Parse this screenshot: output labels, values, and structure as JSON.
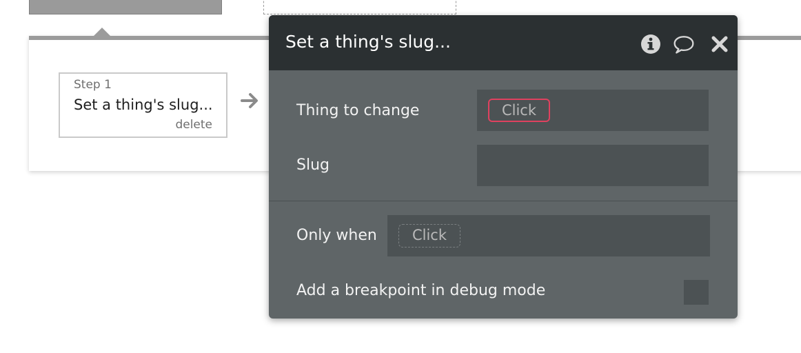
{
  "workflow": {
    "step": {
      "number_label": "Step 1",
      "title": "Set a thing's slug...",
      "delete_label": "delete"
    }
  },
  "editor": {
    "title": "Set a thing's slug...",
    "icons": {
      "info": "info-icon",
      "comment": "comment-icon",
      "close": "close-icon"
    },
    "fields": {
      "thing_to_change": {
        "label": "Thing to change",
        "value": "Click"
      },
      "slug": {
        "label": "Slug",
        "value": ""
      },
      "only_when": {
        "label": "Only when",
        "value": "Click"
      },
      "breakpoint": {
        "label": "Add a breakpoint in debug mode",
        "checked": false
      }
    }
  },
  "colors": {
    "header_bg": "#2b3032",
    "panel_bg": "#5f6567",
    "field_bg": "#4c5254",
    "error_outline": "#e0415f"
  }
}
